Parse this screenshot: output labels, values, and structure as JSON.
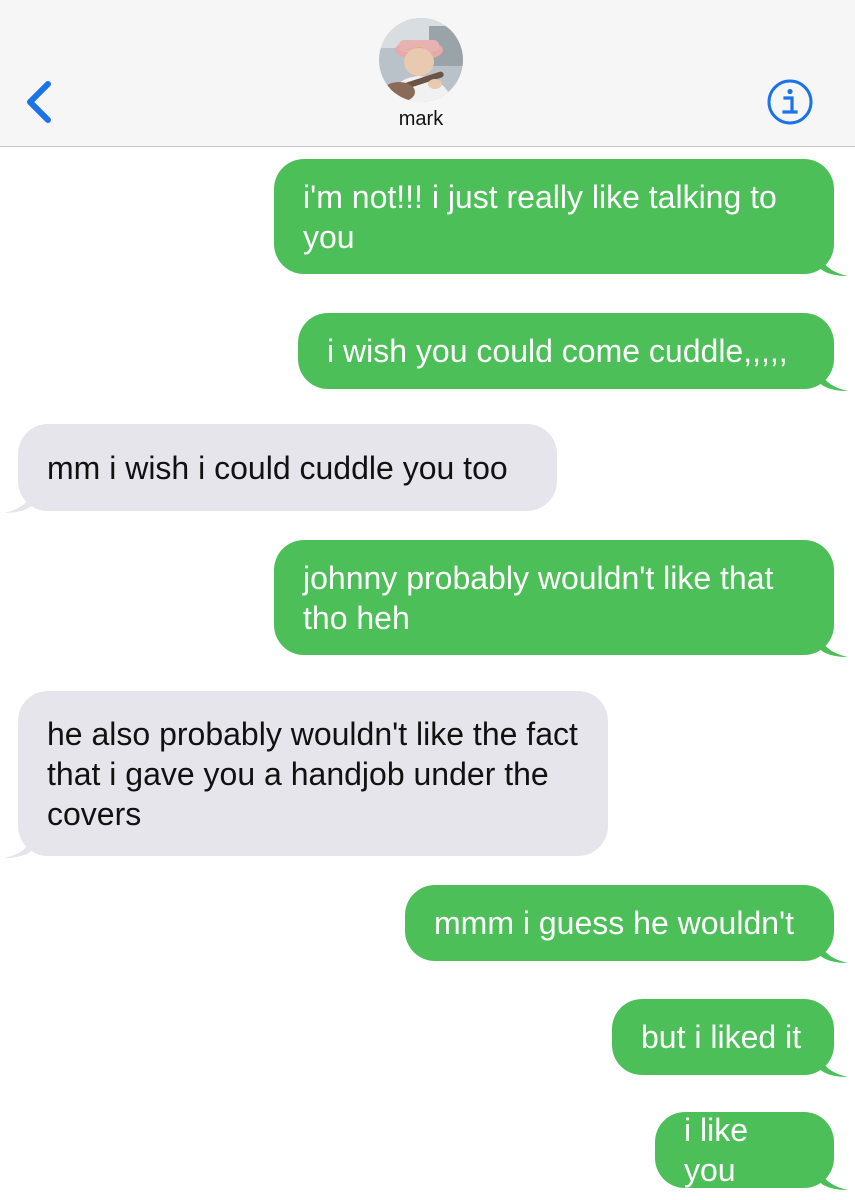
{
  "header": {
    "contact_name": "mark",
    "back_icon": "chevron-left-icon",
    "info_icon": "info-circle-icon",
    "accent_color": "#1a73e8"
  },
  "colors": {
    "sent_bubble": "#4cbf59",
    "received_bubble": "#e6e5eb"
  },
  "messages": [
    {
      "direction": "sent",
      "text": "i'm not!!! i just really like talking to you"
    },
    {
      "direction": "sent",
      "text": "i wish you could come cuddle,,,,,"
    },
    {
      "direction": "received",
      "text": "mm i wish i could cuddle you too"
    },
    {
      "direction": "sent",
      "text": "johnny probably wouldn't like that tho heh"
    },
    {
      "direction": "received",
      "text": "he also probably wouldn't like the fact that i gave you a handjob under the covers"
    },
    {
      "direction": "sent",
      "text": "mmm i guess he wouldn't"
    },
    {
      "direction": "sent",
      "text": "but i liked it"
    },
    {
      "direction": "sent",
      "text": "i like you"
    }
  ]
}
